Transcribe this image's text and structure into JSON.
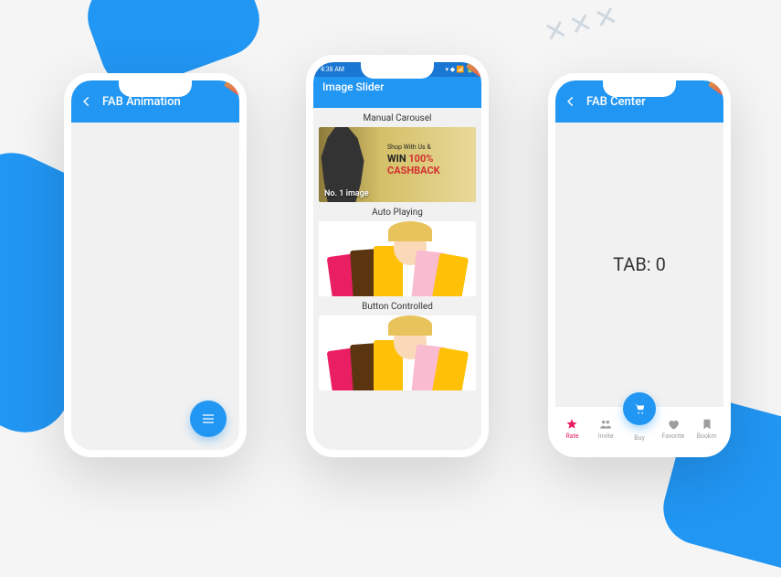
{
  "phones": {
    "fab_animation": {
      "appbar_title": "FAB Animation"
    },
    "image_slider": {
      "status_time": "4:38 AM",
      "appbar_title": "Image Slider",
      "sections": {
        "manual": "Manual Carousel",
        "auto": "Auto Playing",
        "button": "Button Controlled"
      },
      "banner": {
        "tag": "Shop With Us &",
        "win": "WIN",
        "cashback": "100% CASHBACK",
        "caption": "No. 1 image"
      }
    },
    "fab_center": {
      "appbar_title": "FAB Center",
      "body": "TAB: 0",
      "nav": {
        "rate": "Rate",
        "invite": "Invite",
        "buy": "Buy",
        "favorite": "Favorite",
        "bookmark": "Bookm"
      }
    }
  }
}
